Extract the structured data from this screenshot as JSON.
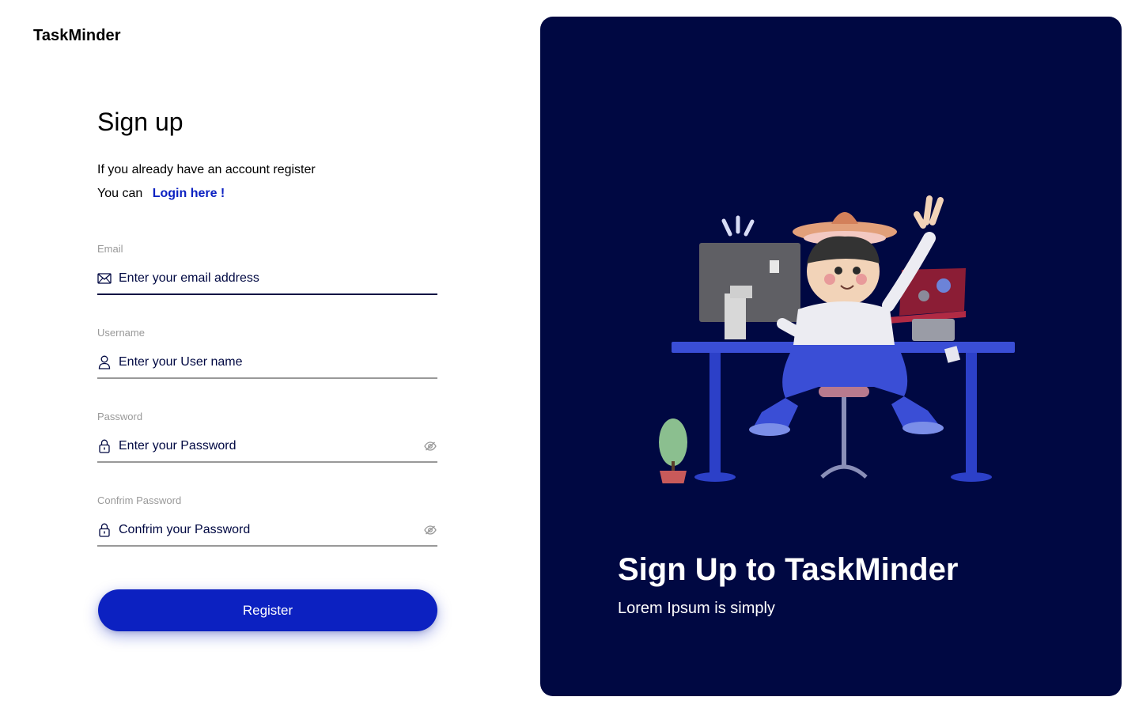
{
  "brand": {
    "name": "TaskMinder"
  },
  "form": {
    "title": "Sign up",
    "subtitle_line1": "If you already have an account register",
    "subtitle_line2_prefix": "You can",
    "login_link": "Login here !",
    "fields": [
      {
        "label": "Email",
        "placeholder": "Enter your email address",
        "icon": "envelope-icon"
      },
      {
        "label": "Username",
        "placeholder": "Enter your User name",
        "icon": "user-icon"
      },
      {
        "label": "Password",
        "placeholder": "Enter your Password",
        "icon": "lock-icon",
        "toggle_icon": "eye-off-icon"
      },
      {
        "label": "Confrim Password",
        "placeholder": "Confrim your Password",
        "icon": "lock-icon",
        "toggle_icon": "eye-off-icon"
      }
    ],
    "register_label": "Register"
  },
  "panel": {
    "title": "Sign Up to TaskMinder",
    "subtitle": "Lorem Ipsum is simply"
  },
  "colors": {
    "accent": "#0c21c1",
    "panel_bg": "#000842",
    "muted": "#999999"
  }
}
